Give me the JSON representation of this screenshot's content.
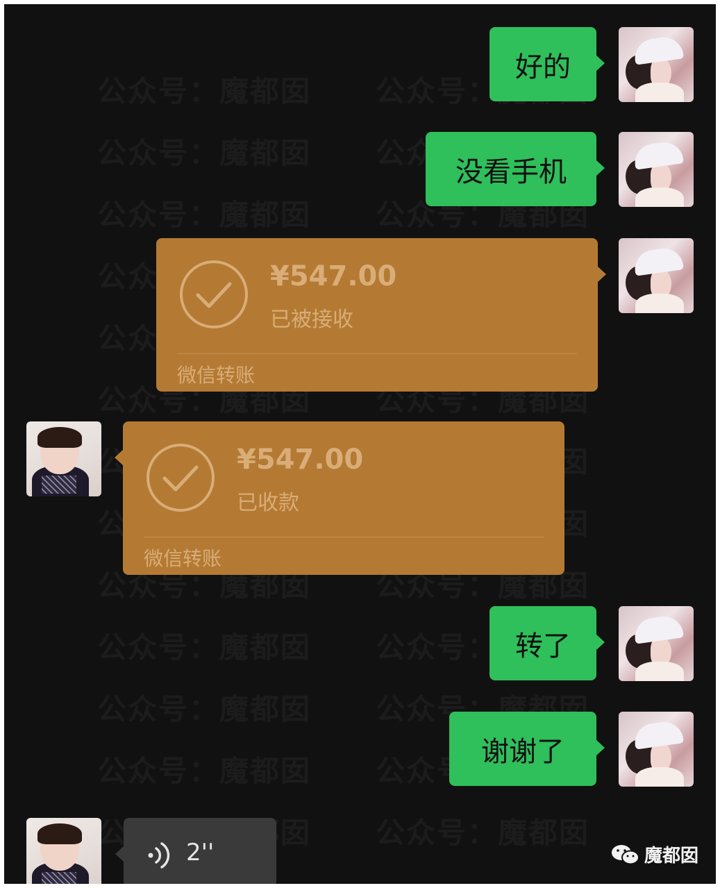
{
  "watermark": "公众号：魔都囡",
  "messages": [
    {
      "type": "text",
      "side": "right",
      "text": "好的"
    },
    {
      "type": "text",
      "side": "right",
      "text": "没看手机"
    },
    {
      "type": "transfer",
      "side": "right",
      "amount": "¥547.00",
      "status": "已被接收",
      "label": "微信转账"
    },
    {
      "type": "transfer",
      "side": "left",
      "amount": "¥547.00",
      "status": "已收款",
      "label": "微信转账"
    },
    {
      "type": "text",
      "side": "right",
      "text": "转了"
    },
    {
      "type": "text",
      "side": "right",
      "text": "谢谢了"
    },
    {
      "type": "voice",
      "side": "left",
      "duration": "2''"
    }
  ],
  "brand": {
    "name": "魔都囡",
    "icon": "wechat-official-account-icon"
  },
  "colors": {
    "background": "#111111",
    "bubble_green": "#2fbf5b",
    "transfer_orange": "#b47a33",
    "transfer_text": "#d9ad78",
    "voice_bubble": "#3a3a3a"
  }
}
